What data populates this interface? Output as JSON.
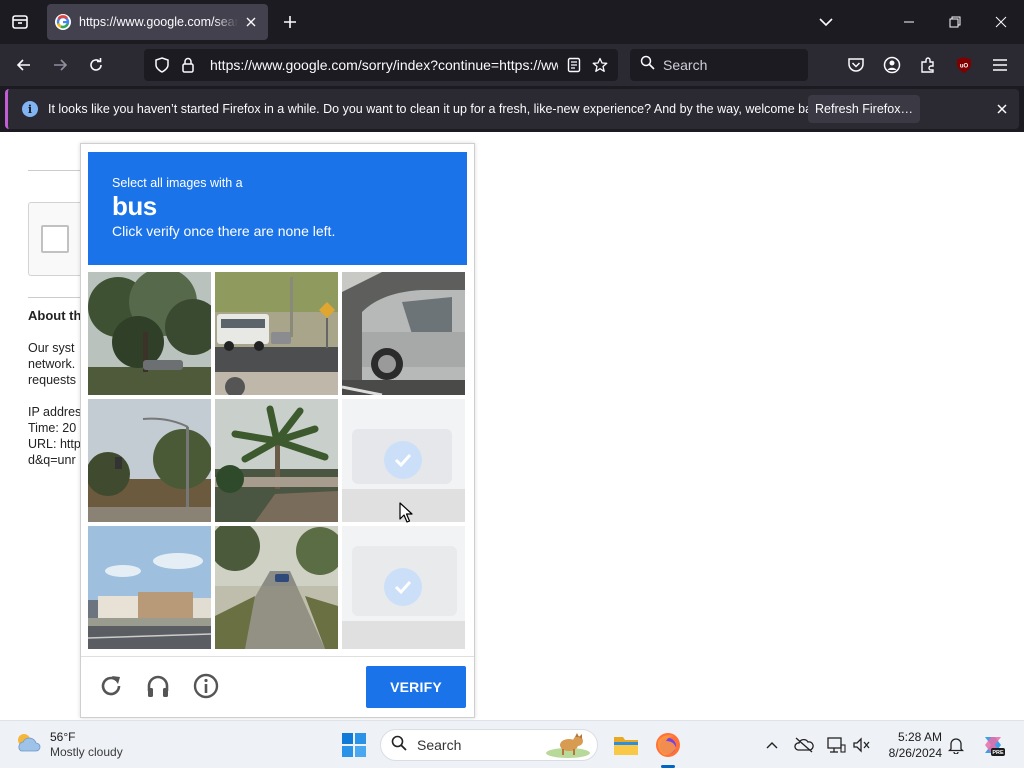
{
  "browser": {
    "tab": {
      "title": "https://www.google.com/search"
    },
    "url": "https://www.google.com/sorry/index?continue=https://www.google.com/search",
    "search_placeholder": "Search",
    "notification": {
      "message": "It looks like you haven’t started Firefox in a while. Do you want to clean it up for a fresh, like-new experience? And by the way, welcome back!",
      "button_label": "Refresh Firefox…"
    },
    "accent_color": "#c25dd6"
  },
  "background_page": {
    "about_heading": "About th",
    "lines": [
      "Our syst",
      "network.",
      "requests",
      "",
      "IP addres",
      "Time: 20",
      "URL: http",
      "d&q=unr"
    ]
  },
  "captcha": {
    "prompt_prefix": "Select all images with a",
    "target_object": "bus",
    "instruction": "Click verify once there are none left.",
    "header_color": "#1a73e8",
    "tiles": [
      {
        "name": "trees-tile",
        "selected": false
      },
      {
        "name": "bus-street-tile",
        "selected": false
      },
      {
        "name": "silver-car-tile",
        "selected": false
      },
      {
        "name": "streetlight-tile",
        "selected": false
      },
      {
        "name": "palm-tree-tile",
        "selected": false
      },
      {
        "name": "faded-tile",
        "selected": true
      },
      {
        "name": "building-tile",
        "selected": false
      },
      {
        "name": "road-tile",
        "selected": false
      },
      {
        "name": "faded-tile",
        "selected": true
      }
    ],
    "verify_label": "VERIFY",
    "icons": [
      "reload-icon",
      "audio-icon",
      "info-icon"
    ]
  },
  "taskbar": {
    "weather_temp": "56°F",
    "weather_condition": "Mostly cloudy",
    "search_placeholder": "Search",
    "time": "5:28 AM",
    "date": "8/26/2024"
  }
}
